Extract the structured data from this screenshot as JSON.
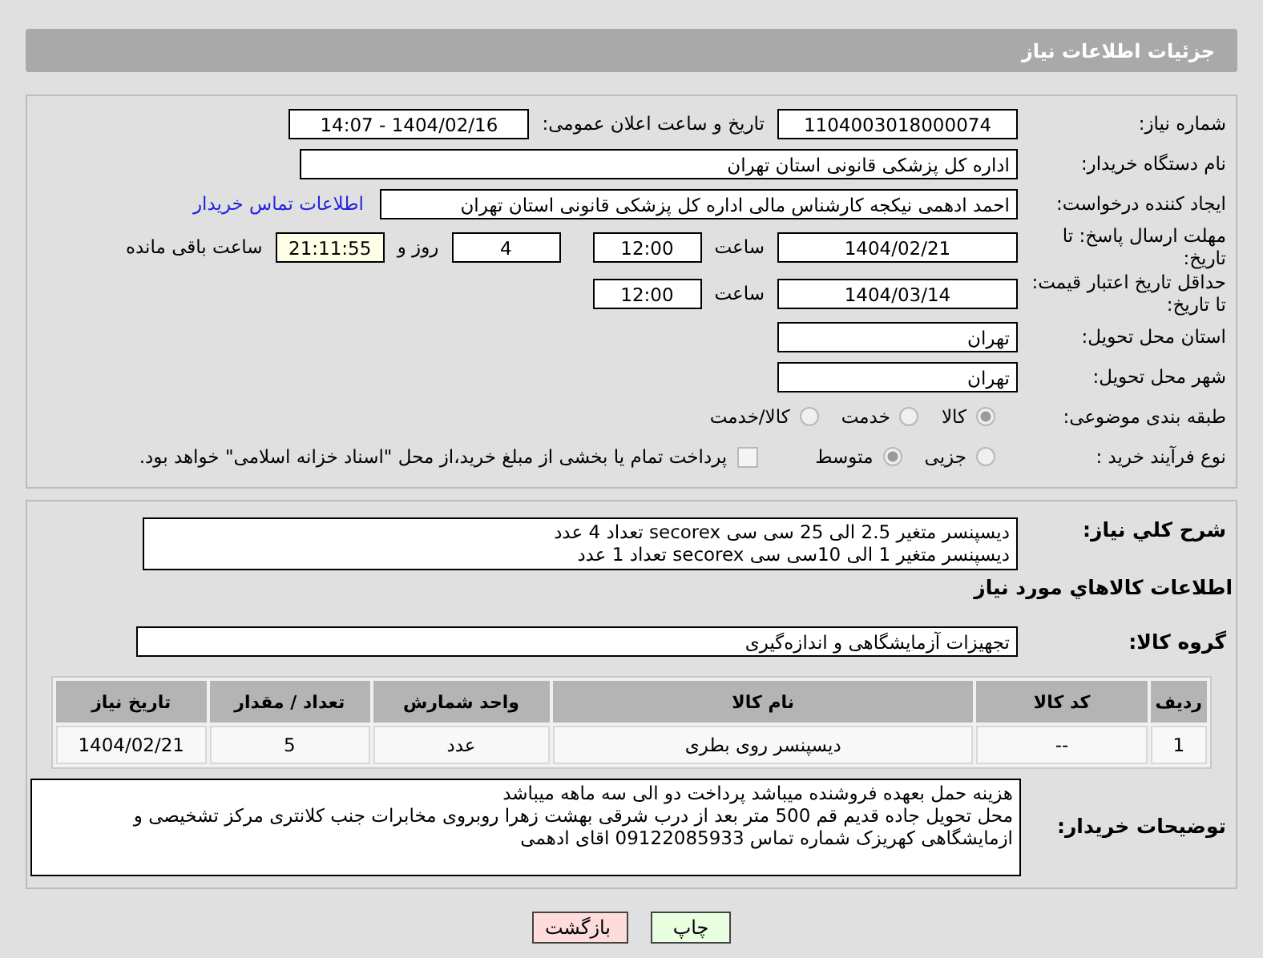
{
  "header": {
    "title": "جزئیات اطلاعات نیاز"
  },
  "details": {
    "need_number": {
      "label": "شماره نیاز:",
      "value": "1104003018000074"
    },
    "announce": {
      "label": "تاریخ و ساعت اعلان عمومی:",
      "value": "1404/02/16 - 14:07"
    },
    "buyer": {
      "label": "نام دستگاه خریدار:",
      "value": "اداره کل پزشکی قانونی استان تهران"
    },
    "creator": {
      "label": "ایجاد کننده درخواست:",
      "value": "احمد ادهمی نیکجه کارشناس مالی اداره کل پزشکی قانونی استان تهران",
      "link": "اطلاعات تماس خریدار"
    },
    "deadline": {
      "label": "مهلت ارسال پاسخ: تا تاریخ:",
      "date": "1404/02/21",
      "time_label": "ساعت",
      "time": "12:00",
      "days": "4",
      "days_label": "روز و",
      "remaining": "21:11:55",
      "remaining_label": "ساعت باقی مانده"
    },
    "validity": {
      "label": "حداقل تاریخ اعتبار قیمت: تا تاریخ:",
      "date": "1404/03/14",
      "time_label": "ساعت",
      "time": "12:00"
    },
    "province": {
      "label": "استان محل تحویل:",
      "value": "تهران"
    },
    "city": {
      "label": "شهر محل تحویل:",
      "value": "تهران"
    },
    "category": {
      "label": "طبقه بندی موضوعی:",
      "options": [
        {
          "label": "کالا",
          "selected": true
        },
        {
          "label": "خدمت",
          "selected": false
        },
        {
          "label": "کالا/خدمت",
          "selected": false
        }
      ]
    },
    "process": {
      "label": "نوع فرآیند خرید :",
      "options": [
        {
          "label": "جزیی",
          "selected": false
        },
        {
          "label": "متوسط",
          "selected": true
        }
      ],
      "payment": {
        "checked": false,
        "text": "پرداخت تمام یا بخشی از مبلغ خرید،از محل \"اسناد خزانه اسلامی\" خواهد بود."
      }
    }
  },
  "goods": {
    "summary": {
      "label": "شرح کلي نياز:",
      "lines": [
        "دیسپنسر متغیر 2.5 الی 25 سی سی secorex تعداد 4 عدد",
        "دیسپنسر متغیر 1 الی 10سی سی secorex تعداد 1 عدد"
      ]
    },
    "heading": "اطلاعات كالاهاي مورد نياز",
    "group": {
      "label": "گروه کالا:",
      "value": "تجهیزات آزمایشگاهی و اندازه‌گیری"
    },
    "table": {
      "columns": [
        "ردیف",
        "کد کالا",
        "نام کالا",
        "واحد شمارش",
        "تعداد / مقدار",
        "تاریخ نیاز"
      ],
      "rows": [
        [
          "1",
          "--",
          "دیسپنسر روی بطری",
          "عدد",
          "5",
          "1404/02/21"
        ]
      ]
    },
    "notes": {
      "label": "توضیحات خریدار:",
      "lines": [
        "هزینه حمل بعهده فروشنده میباشد پرداخت دو الی سه ماهه میباشد",
        "محل تحویل جاده قدیم قم 500 متر بعد از درب شرقی بهشت زهرا روبروی مخابرات جنب کلانتری مرکز تشخیصی و",
        "ازمایشگاهی کهریزک شماره تماس 09122085933 اقای ادهمی"
      ]
    }
  },
  "buttons": [
    {
      "label": "چاپ",
      "kind": "print"
    },
    {
      "label": "بازگشت",
      "kind": "back"
    }
  ]
}
